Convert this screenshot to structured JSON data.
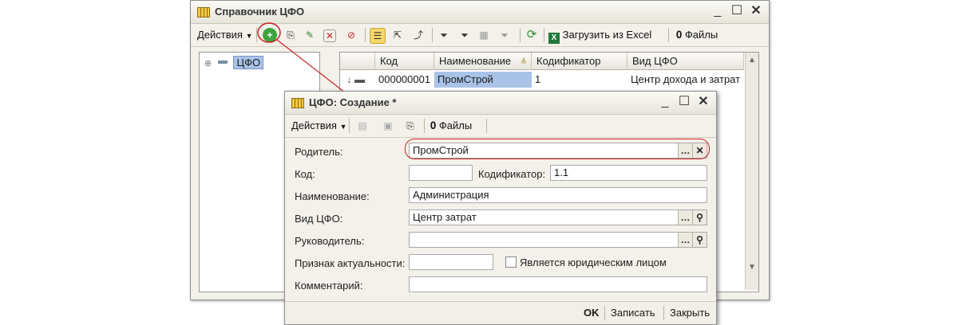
{
  "main_window": {
    "title": "Справочник ЦФО",
    "toolbar": {
      "actions_label": "Действия",
      "load_excel_label": "Загрузить из Excel",
      "files_label": "Файлы"
    },
    "tree": {
      "root_label": "ЦФО"
    },
    "table": {
      "columns": [
        "Код",
        "Наименование",
        "Кодификатор",
        "Вид ЦФО"
      ],
      "rows": [
        {
          "code": "000000001",
          "name": "ПромСтрой",
          "codifier": "1",
          "type": "Центр дохода и затрат"
        }
      ]
    }
  },
  "dialog": {
    "title": "ЦФО: Создание *",
    "toolbar": {
      "actions_label": "Действия",
      "files_label": "Файлы"
    },
    "fields": {
      "parent": {
        "label": "Родитель:",
        "value": "ПромСтрой"
      },
      "code": {
        "label": "Код:",
        "value": ""
      },
      "codifier": {
        "label": "Кодификатор:",
        "value": "1.1"
      },
      "name": {
        "label": "Наименование:",
        "value": "Администрация"
      },
      "type": {
        "label": "Вид ЦФО:",
        "value": "Центр затрат"
      },
      "manager": {
        "label": "Руководитель:",
        "value": ""
      },
      "relevance": {
        "label": "Признак актуальности:",
        "value": ""
      },
      "legal_entity": {
        "label": "Является юридическим лицом",
        "checked": false
      },
      "comment": {
        "label": "Комментарий:",
        "value": ""
      }
    },
    "buttons": {
      "ok": "OK",
      "save": "Записать",
      "close": "Закрыть"
    }
  },
  "colors": {
    "highlight": "#cc2222",
    "selection": "#a9c3e8",
    "window_bg": "#f3f1ea"
  }
}
